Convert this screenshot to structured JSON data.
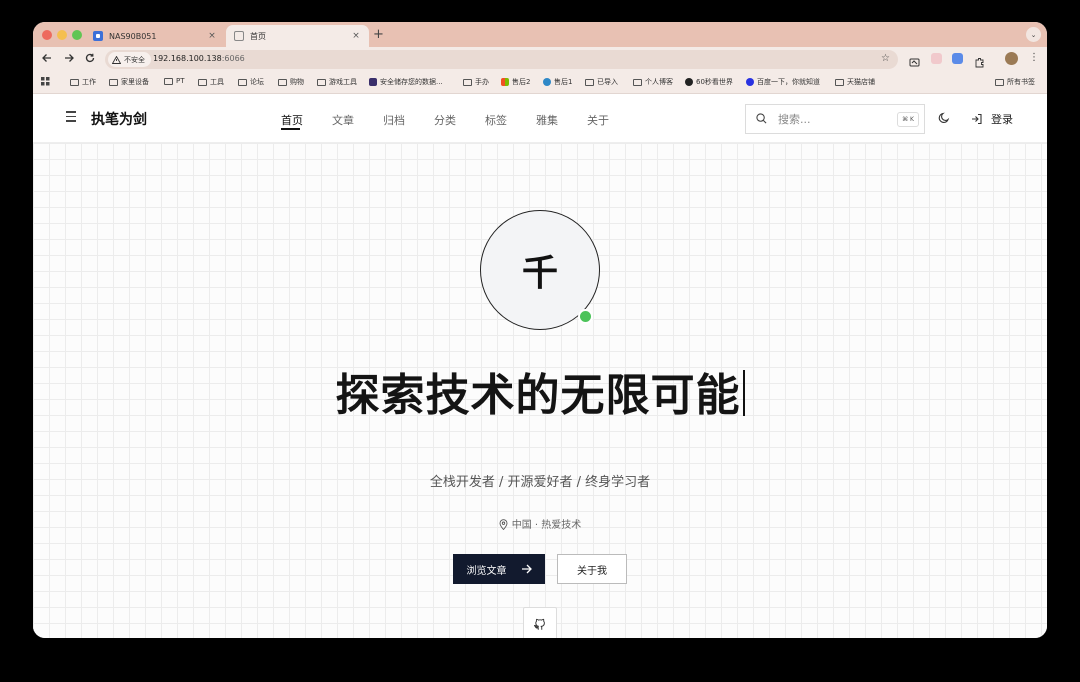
{
  "browser": {
    "tabs": [
      {
        "title": "NAS90B051",
        "close": "×"
      },
      {
        "title": "首页",
        "close": "×"
      }
    ],
    "new_tab": "+",
    "tab_menu": "⌄",
    "security_label": "不安全",
    "url_host": "192.168.100.138",
    "url_port": ":6066",
    "bookmarks": [
      {
        "label": "工作",
        "icon": "folder-icon"
      },
      {
        "label": "家里设备",
        "icon": "folder-icon"
      },
      {
        "label": "PT",
        "icon": "folder-icon"
      },
      {
        "label": "工具",
        "icon": "folder-icon"
      },
      {
        "label": "论坛",
        "icon": "folder-icon"
      },
      {
        "label": "购物",
        "icon": "folder-icon"
      },
      {
        "label": "游戏工具",
        "icon": "folder-icon"
      },
      {
        "label": "安全储存您的数据...",
        "icon": "site-icon"
      },
      {
        "label": "手办",
        "icon": "folder-icon"
      },
      {
        "label": "售后2",
        "icon": "windows-icon"
      },
      {
        "label": "售后1",
        "icon": "site-icon"
      },
      {
        "label": "已导入",
        "icon": "folder-icon"
      },
      {
        "label": "个人博客",
        "icon": "folder-icon"
      },
      {
        "label": "60秒看世界",
        "icon": "site-icon"
      },
      {
        "label": "百度一下，你就知道",
        "icon": "baidu-icon"
      },
      {
        "label": "天猫店铺",
        "icon": "folder-icon"
      },
      {
        "label": "所有书签",
        "icon": "folder-icon"
      }
    ]
  },
  "site": {
    "brand": "执笔为剑",
    "nav": [
      {
        "label": "首页",
        "active": true
      },
      {
        "label": "文章",
        "active": false
      },
      {
        "label": "归档",
        "active": false
      },
      {
        "label": "分类",
        "active": false
      },
      {
        "label": "标签",
        "active": false
      },
      {
        "label": "雅集",
        "active": false
      },
      {
        "label": "关于",
        "active": false
      }
    ],
    "search_placeholder": "搜索...",
    "search_shortcut": "⌘ K",
    "login": "登录"
  },
  "hero": {
    "avatar_char": "千",
    "title": "探索技术的无限可能",
    "subtitle": "全栈开发者 / 开源爱好者 / 终身学习者",
    "location": "中国 · 热爱技术",
    "primary_button": "浏览文章",
    "secondary_button": "关于我"
  },
  "colors": {
    "tab_strip": "#e8c1b3",
    "primary_button_bg": "#121a2e",
    "online_status": "#4cc35a"
  }
}
